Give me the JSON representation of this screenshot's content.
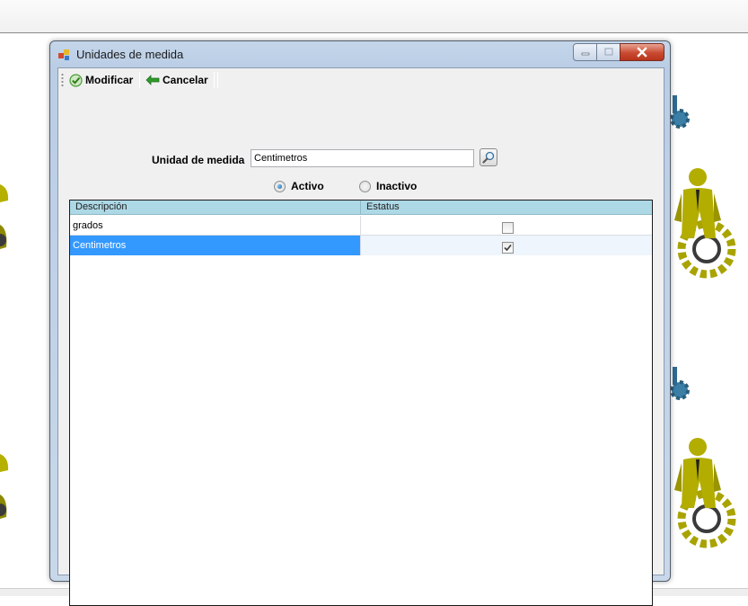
{
  "window": {
    "title": "Unidades de medida"
  },
  "toolbar": {
    "modify_label": "Modificar",
    "cancel_label": "Cancelar"
  },
  "form": {
    "unit_label": "Unidad de medida",
    "unit_value": "Centimetros",
    "radio_active_label": "Activo",
    "radio_inactive_label": "Inactivo",
    "selected_radio": "Activo"
  },
  "grid": {
    "columns": [
      "Descripción",
      "Estatus"
    ],
    "rows": [
      {
        "descripcion": "grados",
        "estatus": false
      },
      {
        "descripcion": "Centimetros",
        "estatus": true
      }
    ],
    "selected_row": 1
  },
  "colors": {
    "header_bg": "#add8e6",
    "selection": "#3399ff",
    "close_button": "#c94a31"
  }
}
